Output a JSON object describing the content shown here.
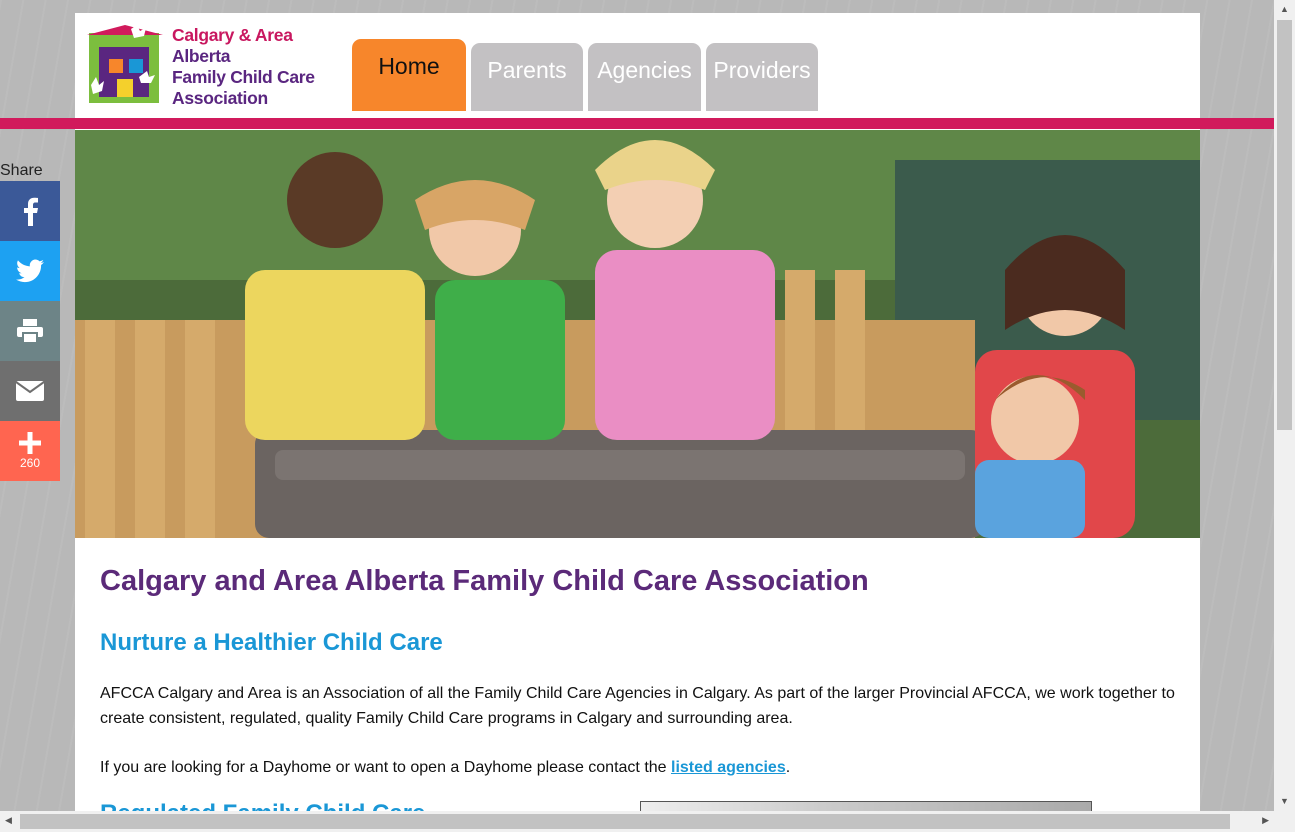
{
  "logo": {
    "line1": "Calgary & Area",
    "line2": "Alberta",
    "line3": "Family Child Care",
    "line4": "Association"
  },
  "nav": {
    "tabs": [
      {
        "label": "Home",
        "active": true
      },
      {
        "label": "Parents",
        "active": false
      },
      {
        "label": "Agencies",
        "active": false
      },
      {
        "label": "Providers",
        "active": false
      }
    ]
  },
  "share": {
    "label": "Share",
    "buttons": [
      {
        "icon": "facebook-icon",
        "color": "#3b5998"
      },
      {
        "icon": "twitter-icon",
        "color": "#1da1f2"
      },
      {
        "icon": "print-icon",
        "color": "#6d8487"
      },
      {
        "icon": "email-icon",
        "color": "#6f6f6f"
      },
      {
        "icon": "plus-icon",
        "color": "#ff6550",
        "count": "260"
      }
    ]
  },
  "content": {
    "title": "Calgary and Area Alberta Family Child Care Association",
    "subtitle": "Nurture a Healthier Child Care",
    "para1": "AFCCA Calgary and Area is an Association of all the Family Child Care Agencies in Calgary. As part of the larger Provincial AFCCA, we work together to create consistent, regulated, quality Family Child Care programs in Calgary and surrounding area.",
    "para2_before": "If you are looking for a Dayhome or want to open a Dayhome please contact the ",
    "para2_link": "listed agencies",
    "para2_after": ".",
    "cut_heading": "Regulated Family Child Care"
  },
  "colors": {
    "accent_orange": "#f7862b",
    "brand_pink": "#d11a5c",
    "brand_purple": "#5b2a79",
    "link_blue": "#1a97d6"
  }
}
